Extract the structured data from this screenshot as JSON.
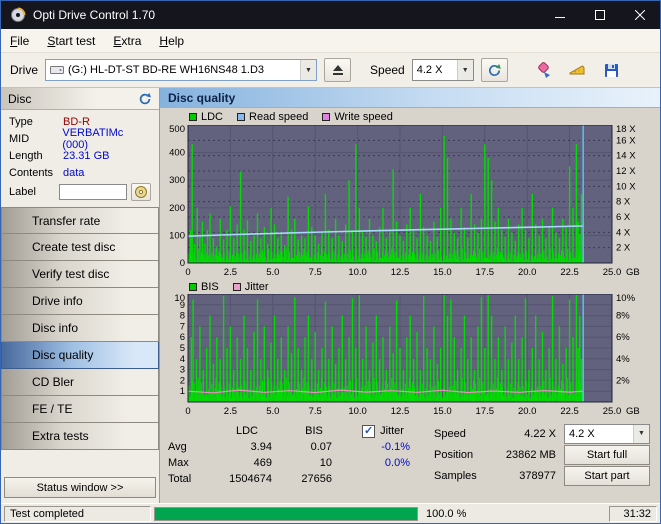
{
  "window": {
    "title": "Opti Drive Control 1.70"
  },
  "menu": {
    "items": [
      "File",
      "Start test",
      "Extra",
      "Help"
    ]
  },
  "toolbar": {
    "drive_label": "Drive",
    "drive_value": "(G:) HL-DT-ST BD-RE WH16NS48 1.D3",
    "speed_label": "Speed",
    "speed_value": "4.2 X"
  },
  "icons": {
    "combo_arrow": "▼",
    "check": "✓"
  },
  "sidebar": {
    "disc_header": "Disc",
    "info": [
      {
        "label": "Type",
        "value": "BD-R"
      },
      {
        "label": "MID",
        "value": "VERBATIMc (000)"
      },
      {
        "label": "Length",
        "value": "23.31 GB"
      },
      {
        "label": "Contents",
        "value": "data"
      }
    ],
    "label_label": "Label",
    "label_value": "",
    "buttons": [
      "Transfer rate",
      "Create test disc",
      "Verify test disc",
      "Drive info",
      "Disc info",
      "Disc quality",
      "CD Bler",
      "FE / TE",
      "Extra tests"
    ],
    "active_button": "Disc quality",
    "status_window_label": "Status window >>"
  },
  "panel": {
    "title": "Disc quality"
  },
  "stats": {
    "columns": [
      "LDC",
      "BIS"
    ],
    "jitter_label": "Jitter",
    "rows": [
      {
        "label": "Avg",
        "ldc": "3.94",
        "bis": "0.07",
        "jitter": "-0.1%"
      },
      {
        "label": "Max",
        "ldc": "469",
        "bis": "10",
        "jitter": "0.0%"
      },
      {
        "label": "Total",
        "ldc": "1504674",
        "bis": "27656",
        "jitter": ""
      }
    ],
    "right": [
      {
        "label": "Speed",
        "value": "4.22 X",
        "control": "combo",
        "control_label": "4.2 X"
      },
      {
        "label": "Position",
        "value": "23862 MB",
        "control": "button",
        "control_label": "Start full"
      },
      {
        "label": "Samples",
        "value": "378977",
        "control": "button",
        "control_label": "Start part"
      }
    ]
  },
  "statusbar": {
    "status": "Test completed",
    "percent": "100.0 %",
    "progress_value": 100,
    "time": "31:32",
    "progress_color": "#00a550"
  },
  "colors": {
    "value_blue": "#0008cc",
    "type_red": "#990000",
    "bar_green": "#00dd00",
    "progress_green": "#00a550",
    "plot_background": "#62627e",
    "active_button_blue": "#9fc0e4"
  },
  "chart_data": [
    {
      "name": "ldc-read-speed",
      "type": "bar",
      "title": "",
      "legend": [
        {
          "label": "LDC",
          "color": "#00cc00"
        },
        {
          "label": "Read speed",
          "color": "#8ab8e8"
        },
        {
          "label": "Write speed",
          "color": "#e080e0"
        }
      ],
      "x_max": 25,
      "x_unit": "GB",
      "x_tick_values": [
        0,
        2.5,
        5,
        7.5,
        10,
        12.5,
        15,
        17.5,
        20,
        22.5,
        25
      ],
      "x_tick_labels": [
        "0",
        "2.5",
        "5.0",
        "7.5",
        "10.0",
        "12.5",
        "15.0",
        "17.5",
        "20.0",
        "22.5",
        "25.0"
      ],
      "y_left": {
        "max": 500,
        "tick_values": [
          0,
          100,
          200,
          300,
          400,
          500
        ],
        "tick_labels": [
          "0",
          "100",
          "200",
          "300",
          "400",
          "500"
        ],
        "grid": [
          100,
          200,
          300,
          400
        ]
      },
      "y_right": {
        "max": 18,
        "tick_values": [
          2,
          4,
          6,
          8,
          10,
          12,
          14,
          16,
          18
        ],
        "tick_labels": [
          "2 X",
          "4 X",
          "6 X",
          "8 X",
          "10 X",
          "12 X",
          "14 X",
          "16 X",
          "18 X"
        ],
        "dashed_grid": true
      },
      "plot_bg": "#62627e",
      "grid_color": "#55556e",
      "bar_color": "#00dd00",
      "speed_color": "#a8d8f8",
      "end_marker_color": "#58c8f8",
      "data_end": 23.3,
      "noise_step": 0.061,
      "noise_pattern": [
        18,
        35,
        10,
        28,
        45,
        15,
        38,
        22,
        8,
        30,
        52,
        12,
        25,
        40,
        16,
        33,
        20
      ],
      "spikes": [
        [
          0.15,
          120
        ],
        [
          0.25,
          430
        ],
        [
          0.4,
          70
        ],
        [
          0.55,
          200
        ],
        [
          0.7,
          95
        ],
        [
          0.85,
          150
        ],
        [
          1.0,
          70
        ],
        [
          1.15,
          120
        ],
        [
          1.3,
          180
        ],
        [
          1.5,
          90
        ],
        [
          1.7,
          60
        ],
        [
          1.9,
          160
        ],
        [
          2.1,
          85
        ],
        [
          2.3,
          120
        ],
        [
          2.5,
          205
        ],
        [
          2.7,
          90
        ],
        [
          2.9,
          140
        ],
        [
          3.1,
          330
        ],
        [
          3.3,
          120
        ],
        [
          3.5,
          155
        ],
        [
          3.7,
          80
        ],
        [
          3.9,
          100
        ],
        [
          4.1,
          180
        ],
        [
          4.3,
          90
        ],
        [
          4.5,
          130
        ],
        [
          4.7,
          70
        ],
        [
          4.9,
          200
        ],
        [
          5.1,
          140
        ],
        [
          5.3,
          90
        ],
        [
          5.5,
          110
        ],
        [
          5.7,
          65
        ],
        [
          5.9,
          240
        ],
        [
          6.1,
          120
        ],
        [
          6.3,
          160
        ],
        [
          6.5,
          85
        ],
        [
          6.7,
          100
        ],
        [
          6.9,
          90
        ],
        [
          7.1,
          205
        ],
        [
          7.3,
          130
        ],
        [
          7.5,
          100
        ],
        [
          7.7,
          70
        ],
        [
          7.9,
          110
        ],
        [
          8.1,
          250
        ],
        [
          8.3,
          120
        ],
        [
          8.5,
          90
        ],
        [
          8.7,
          160
        ],
        [
          8.9,
          100
        ],
        [
          9.1,
          80
        ],
        [
          9.3,
          140
        ],
        [
          9.5,
          300
        ],
        [
          9.7,
          120
        ],
        [
          9.9,
          430
        ],
        [
          10.1,
          200
        ],
        [
          10.3,
          120
        ],
        [
          10.5,
          95
        ],
        [
          10.7,
          160
        ],
        [
          10.9,
          100
        ],
        [
          11.1,
          80
        ],
        [
          11.3,
          130
        ],
        [
          11.5,
          200
        ],
        [
          11.7,
          90
        ],
        [
          11.9,
          120
        ],
        [
          12.1,
          340
        ],
        [
          12.3,
          150
        ],
        [
          12.5,
          100
        ],
        [
          12.7,
          80
        ],
        [
          12.9,
          140
        ],
        [
          13.1,
          200
        ],
        [
          13.3,
          120
        ],
        [
          13.5,
          90
        ],
        [
          13.7,
          250
        ],
        [
          13.9,
          130
        ],
        [
          14.1,
          100
        ],
        [
          14.3,
          80
        ],
        [
          14.5,
          150
        ],
        [
          14.7,
          95
        ],
        [
          14.9,
          200
        ],
        [
          15.1,
          460
        ],
        [
          15.3,
          380
        ],
        [
          15.5,
          160
        ],
        [
          15.7,
          110
        ],
        [
          15.9,
          90
        ],
        [
          16.1,
          200
        ],
        [
          16.3,
          130
        ],
        [
          16.5,
          90
        ],
        [
          16.7,
          250
        ],
        [
          16.9,
          140
        ],
        [
          17.1,
          110
        ],
        [
          17.3,
          160
        ],
        [
          17.5,
          430
        ],
        [
          17.7,
          380
        ],
        [
          17.9,
          300
        ],
        [
          18.1,
          150
        ],
        [
          18.3,
          200
        ],
        [
          18.5,
          120
        ],
        [
          18.7,
          95
        ],
        [
          18.9,
          160
        ],
        [
          19.1,
          110
        ],
        [
          19.3,
          80
        ],
        [
          19.5,
          140
        ],
        [
          19.7,
          200
        ],
        [
          19.9,
          120
        ],
        [
          20.1,
          90
        ],
        [
          20.3,
          250
        ],
        [
          20.5,
          140
        ],
        [
          20.7,
          100
        ],
        [
          20.9,
          160
        ],
        [
          21.1,
          90
        ],
        [
          21.3,
          130
        ],
        [
          21.5,
          200
        ],
        [
          21.7,
          110
        ],
        [
          21.9,
          90
        ],
        [
          22.1,
          160
        ],
        [
          22.3,
          130
        ],
        [
          22.5,
          350
        ],
        [
          22.7,
          200
        ],
        [
          22.9,
          430
        ],
        [
          23.0,
          150
        ],
        [
          23.1,
          105
        ],
        [
          23.2,
          250
        ]
      ],
      "speed_line": [
        [
          0,
          3.5
        ],
        [
          2,
          3.65
        ],
        [
          4,
          3.8
        ],
        [
          6,
          3.92
        ],
        [
          8,
          4.04
        ],
        [
          10,
          4.15
        ],
        [
          12,
          4.26
        ],
        [
          14,
          4.36
        ],
        [
          16,
          4.46
        ],
        [
          18,
          4.56
        ],
        [
          20,
          4.66
        ],
        [
          22,
          4.76
        ],
        [
          23.2,
          4.82
        ],
        [
          23.3,
          4.84
        ]
      ]
    },
    {
      "name": "bis-jitter",
      "type": "bar",
      "title": "",
      "legend": [
        {
          "label": "BIS",
          "color": "#00cc00"
        },
        {
          "label": "Jitter",
          "color": "#e8a0c8"
        }
      ],
      "x_max": 25,
      "x_unit": "GB",
      "x_tick_values": [
        0,
        2.5,
        5,
        7.5,
        10,
        12.5,
        15,
        17.5,
        20,
        22.5,
        25
      ],
      "x_tick_labels": [
        "0",
        "2.5",
        "5.0",
        "7.5",
        "10.0",
        "12.5",
        "15.0",
        "17.5",
        "20.0",
        "22.5",
        "25.0"
      ],
      "y_left": {
        "max": 10,
        "tick_values": [
          1,
          2,
          3,
          4,
          5,
          6,
          7,
          8,
          9,
          10
        ],
        "tick_labels": [
          "1",
          "2",
          "3",
          "4",
          "5",
          "6",
          "7",
          "8",
          "9",
          "10"
        ],
        "grid": [
          1,
          2,
          3,
          4,
          5,
          6,
          7,
          8,
          9
        ]
      },
      "y_right": {
        "max": 10,
        "tick_values": [
          2,
          4,
          6,
          8,
          10
        ],
        "tick_labels": [
          "2%",
          "4%",
          "6%",
          "8%",
          "10%"
        ],
        "dashed_grid": false
      },
      "plot_bg": "#62627e",
      "grid_color": "#55556e",
      "bar_color": "#00dd00",
      "jitter_color": "#e890c0",
      "end_marker_color": "#58c8f8",
      "data_end": 23.3,
      "noise_step": 0.061,
      "noise_pattern": [
        0.8,
        1.5,
        0.5,
        1.2,
        2.0,
        0.7,
        1.7,
        1.0,
        0.4,
        1.3,
        2.2,
        0.6,
        1.1,
        1.8,
        0.9,
        1.4,
        0.6
      ],
      "spikes": [
        [
          0.2,
          6
        ],
        [
          0.3,
          9.5
        ],
        [
          0.5,
          4
        ],
        [
          0.7,
          7
        ],
        [
          0.9,
          3
        ],
        [
          1.1,
          5
        ],
        [
          1.3,
          8
        ],
        [
          1.5,
          3.5
        ],
        [
          1.7,
          6
        ],
        [
          1.9,
          4
        ],
        [
          2.1,
          9.8
        ],
        [
          2.3,
          5
        ],
        [
          2.5,
          7
        ],
        [
          2.7,
          3
        ],
        [
          2.9,
          6
        ],
        [
          3.1,
          4
        ],
        [
          3.3,
          8
        ],
        [
          3.5,
          5
        ],
        [
          3.7,
          3
        ],
        [
          3.9,
          6.5
        ],
        [
          4.1,
          9.5
        ],
        [
          4.3,
          4
        ],
        [
          4.5,
          7
        ],
        [
          4.7,
          3
        ],
        [
          4.9,
          5.5
        ],
        [
          5.1,
          8
        ],
        [
          5.3,
          4
        ],
        [
          5.5,
          6
        ],
        [
          5.7,
          3
        ],
        [
          5.9,
          7
        ],
        [
          6.1,
          4.5
        ],
        [
          6.3,
          9.7
        ],
        [
          6.5,
          5
        ],
        [
          6.7,
          3
        ],
        [
          6.9,
          6
        ],
        [
          7.1,
          8
        ],
        [
          7.3,
          4
        ],
        [
          7.5,
          6.5
        ],
        [
          7.7,
          3
        ],
        [
          7.9,
          5
        ],
        [
          8.1,
          9.3
        ],
        [
          8.3,
          4
        ],
        [
          8.5,
          7
        ],
        [
          8.7,
          3.5
        ],
        [
          8.9,
          5
        ],
        [
          9.1,
          8
        ],
        [
          9.3,
          4
        ],
        [
          9.5,
          6
        ],
        [
          9.7,
          9.6
        ],
        [
          9.9,
          5
        ],
        [
          10.1,
          9.9
        ],
        [
          10.3,
          4
        ],
        [
          10.5,
          7
        ],
        [
          10.7,
          3
        ],
        [
          10.9,
          5.5
        ],
        [
          11.1,
          8
        ],
        [
          11.3,
          4
        ],
        [
          11.5,
          6
        ],
        [
          11.7,
          3
        ],
        [
          11.9,
          7
        ],
        [
          12.1,
          4.5
        ],
        [
          12.3,
          9.4
        ],
        [
          12.5,
          5
        ],
        [
          12.7,
          3
        ],
        [
          12.9,
          6
        ],
        [
          13.1,
          8
        ],
        [
          13.3,
          4
        ],
        [
          13.5,
          6.5
        ],
        [
          13.7,
          3
        ],
        [
          13.9,
          9.8
        ],
        [
          14.1,
          5
        ],
        [
          14.3,
          4
        ],
        [
          14.5,
          7
        ],
        [
          14.7,
          3.5
        ],
        [
          14.9,
          5
        ],
        [
          15.1,
          9.9
        ],
        [
          15.3,
          8
        ],
        [
          15.5,
          9.5
        ],
        [
          15.7,
          6
        ],
        [
          15.9,
          3
        ],
        [
          16.1,
          5
        ],
        [
          16.3,
          8
        ],
        [
          16.5,
          4
        ],
        [
          16.7,
          6
        ],
        [
          16.9,
          3
        ],
        [
          17.1,
          7
        ],
        [
          17.3,
          9.7
        ],
        [
          17.5,
          5
        ],
        [
          17.7,
          9.9
        ],
        [
          17.9,
          8
        ],
        [
          18.1,
          4
        ],
        [
          18.3,
          6
        ],
        [
          18.5,
          3
        ],
        [
          18.7,
          7
        ],
        [
          18.9,
          4
        ],
        [
          19.1,
          5.5
        ],
        [
          19.3,
          8
        ],
        [
          19.5,
          4
        ],
        [
          19.7,
          6
        ],
        [
          19.9,
          9.6
        ],
        [
          20.1,
          3
        ],
        [
          20.3,
          5
        ],
        [
          20.5,
          8
        ],
        [
          20.7,
          4
        ],
        [
          20.9,
          6.5
        ],
        [
          21.1,
          3
        ],
        [
          21.3,
          5
        ],
        [
          21.5,
          9.8
        ],
        [
          21.7,
          4
        ],
        [
          21.9,
          7
        ],
        [
          22.1,
          3.5
        ],
        [
          22.3,
          5
        ],
        [
          22.5,
          9.5
        ],
        [
          22.7,
          6
        ],
        [
          22.9,
          9.9
        ],
        [
          23.0,
          5
        ],
        [
          23.1,
          8
        ],
        [
          23.2,
          4
        ]
      ],
      "jitter_line": [
        [
          0,
          1.0
        ],
        [
          1.5,
          0.85
        ],
        [
          3,
          1.1
        ],
        [
          4.5,
          0.9
        ],
        [
          6,
          1.05
        ],
        [
          7.5,
          0.88
        ],
        [
          9,
          1.1
        ],
        [
          10.5,
          0.92
        ],
        [
          12,
          1.05
        ],
        [
          13.5,
          0.9
        ],
        [
          15,
          1.08
        ],
        [
          16.5,
          0.88
        ],
        [
          18,
          1.02
        ],
        [
          19.5,
          0.9
        ],
        [
          21,
          1.06
        ],
        [
          22.5,
          0.92
        ],
        [
          23.3,
          1.0
        ]
      ]
    }
  ]
}
